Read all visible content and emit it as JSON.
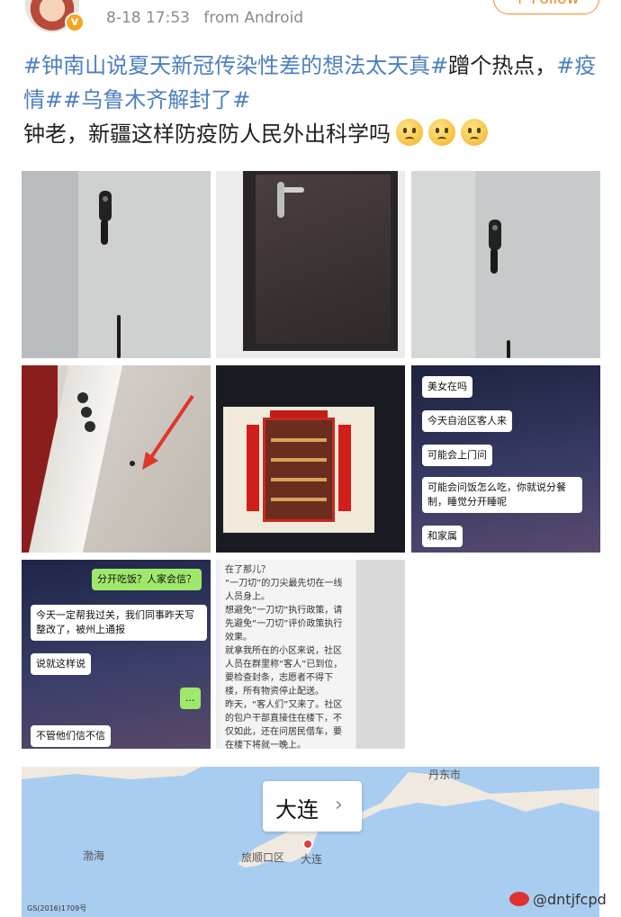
{
  "header": {
    "timestamp": "8-18 17:53",
    "source": "from Android",
    "follow_label": "+ Follow"
  },
  "post": {
    "tag1": "#钟南山说夏天新冠传染性差的想法太天真#",
    "text1": "蹭个热点，",
    "tag2": "#疫情#",
    "tag3": "#乌鲁木齐解封了#",
    "text2": "钟老，新疆这样防疫防人民外出科学吗"
  },
  "chat1": {
    "messages": [
      "美女在吗",
      "今天自治区客人来",
      "可能会上门问",
      "可能会问饭怎么吃，你就说分餐制，睡觉分开睡呢",
      "和家属"
    ]
  },
  "chat2": {
    "messages": [
      "分开吃饭？人家会信？",
      "今天一定帮我过关，我们同事昨天写整改了，被州上通报",
      "说就这样说",
      "...",
      "不管他们信不信"
    ]
  },
  "doc": {
    "lines": [
      "在了那儿？",
      "“一刀切”的刀尖最先切在一线人员身上。",
      "想避免“一刀切”执行政策，请先避免“一刀切”评价政策执行效果。",
      "就拿我所在的小区来说，社区人员在群里称“客人”已到位，要检查封条，志愿者不得下楼，所有物资停止配送。",
      "昨天，“客人们”又来了。社区的包户干部直接住在楼下，不仅如此，还在问居民借车，要在楼下将就一晚上。"
    ]
  },
  "map": {
    "city": "大连",
    "chevron": "›",
    "label_bohai": "渤海",
    "label_lushun": "旅顺口区",
    "label_dalian": "大连",
    "label_top": "丹东市",
    "credit": "GS(2016)1709号"
  },
  "watermark": "@dntjfcpd",
  "icons": {
    "verified": "verified-badge-icon",
    "emoji": "sad-face-emoji-icon",
    "weibo": "weibo-logo-icon"
  },
  "colors": {
    "hashtag": "#4d7fc0",
    "follow": "#f08a24",
    "bubble_green": "#9fe86b",
    "map_water": "#a9cdf0"
  }
}
